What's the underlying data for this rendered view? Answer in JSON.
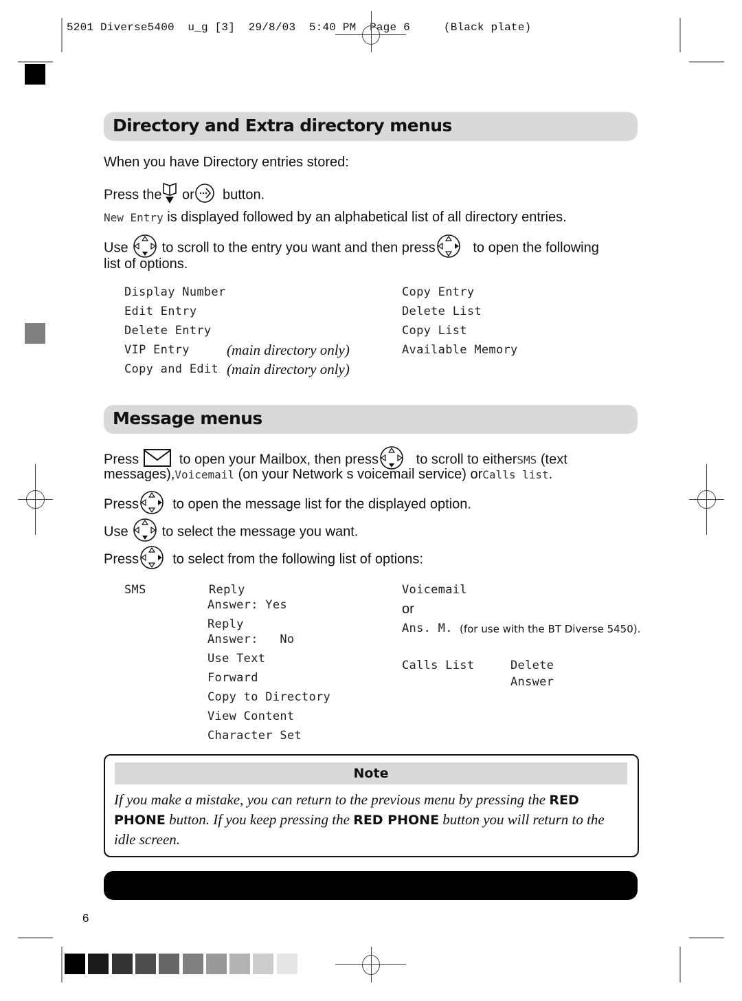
{
  "slug": {
    "text": "5201 Diverse5400  u_g [3]  29/8/03  5:40 PM  Page 6     (Black plate)"
  },
  "sections": {
    "directory": {
      "title": "Directory and Extra directory menus",
      "intro": "When you have Directory entries stored:",
      "press_line": {
        "prefix": "Press the",
        "or": "or",
        "suffix": "button."
      },
      "new_entry_line": {
        "lcd": "New Entry",
        "text": "is displayed followed by an alphabetical list of all directory entries."
      },
      "use_line": {
        "prefix": "Use",
        "middle": "to scroll to the entry you want and then press",
        "suffix": "to open the following",
        "continuation": "list of options."
      },
      "options_left": [
        {
          "label": "Display Number",
          "note": ""
        },
        {
          "label": "Edit Entry",
          "note": ""
        },
        {
          "label": "Delete Entry",
          "note": ""
        },
        {
          "label": "VIP Entry",
          "note": "(main directory only)"
        },
        {
          "label": "Copy and Edit",
          "note": "(main directory only)"
        }
      ],
      "options_right": [
        "Copy Entry",
        "Delete List",
        "Copy List",
        "Available Memory"
      ]
    },
    "messages": {
      "title": "Message menus",
      "line1": {
        "prefix": "Press",
        "middle": "to open your Mailbox, then press",
        "suffix": "to scroll to either",
        "sms": "SMS",
        "sms_after": "(text",
        "line2_prefix": "messages),",
        "voicemail": "Voicemail",
        "line2_middle": "(on your Network s voicemail service) or",
        "calls_list": "Calls list",
        "line2_end": "."
      },
      "line2": {
        "prefix": "Press",
        "text": "to open the message list for the displayed option."
      },
      "line3": {
        "prefix": "Use",
        "text": "to select the message you want."
      },
      "line4": {
        "prefix": "Press",
        "text": "to select from the following list of options:"
      },
      "sms_label": "SMS",
      "sms_options": [
        "Reply",
        "Answer: Yes",
        "Reply",
        "Answer:   No",
        "Use Text",
        "Forward",
        "Copy to Directory",
        "View Content",
        "Character Set"
      ],
      "voicemail_label": "Voicemail",
      "or_text": "or",
      "ans_m_label": "Ans. M.",
      "ans_m_note": "(for use with the BT Diverse 5450).",
      "calls_list_label": "Calls List",
      "calls_list_options": [
        "Delete",
        "Answer"
      ]
    }
  },
  "note": {
    "heading": "Note",
    "text_1": "If you make a mistake, you can return to the previous menu by pressing the",
    "bold_1": "RED PHONE",
    "text_2": "button. If you keep pressing the",
    "bold_2": "RED PHONE",
    "text_3": "button you will return to the idle screen."
  },
  "footer": {
    "page_number": "6"
  },
  "icons": {
    "directory_book": "directory-book-icon",
    "menu_button": "menu-nav-icon",
    "nav_down": "nav-pad-down-icon",
    "nav_right": "nav-pad-right-icon",
    "mailbox": "envelope-icon"
  },
  "colors": {
    "section_bar": "#d9d9d9",
    "text": "#111111",
    "black_bar": "#000000"
  },
  "gray_scale_swatches": [
    "#000000",
    "#1a1a1a",
    "#333333",
    "#4d4d4d",
    "#666666",
    "#808080",
    "#999999",
    "#b3b3b3",
    "#cccccc",
    "#e6e6e6"
  ]
}
